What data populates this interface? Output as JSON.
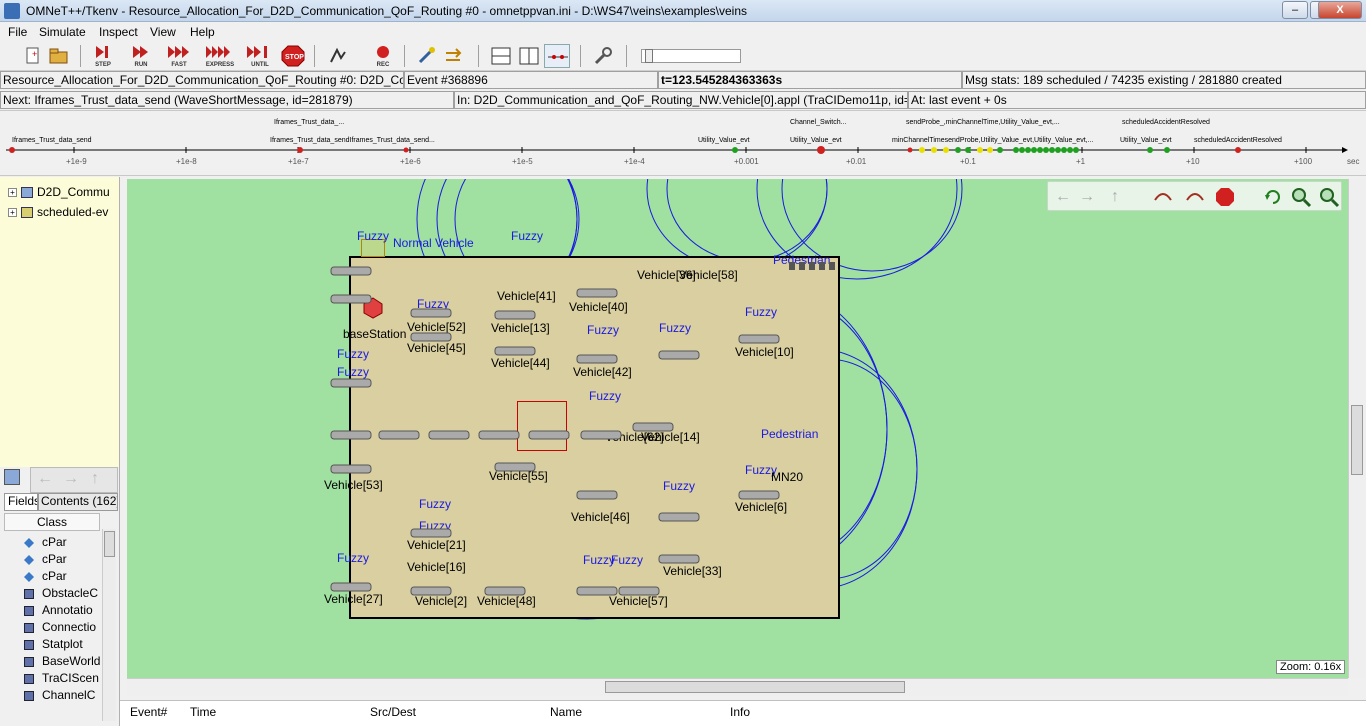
{
  "window": {
    "title": "OMNeT++/Tkenv - Resource_Allocation_For_D2D_Communication_QoF_Routing #0 - omnetppvan.ini - D:\\WS47\\veins\\examples\\veins",
    "minimize": "–",
    "maximize": "□",
    "close": "X"
  },
  "menu": [
    "File",
    "Simulate",
    "Inspect",
    "View",
    "Help"
  ],
  "toolbar": {
    "step": "STEP",
    "run": "RUN",
    "fast": "FAST",
    "express": "EXPRESS",
    "until": "UNTIL",
    "stop": "STOP",
    "rec": "REC"
  },
  "status1": {
    "network": "Resource_Allocation_For_D2D_Communication_QoF_Routing #0: D2D_Communication_and_QoF_Routing_NW",
    "event": "Event #368896",
    "time": "t=123.545284363363s",
    "msgstats": "Msg stats: 189 scheduled / 74235 existing / 281880 created"
  },
  "status2": {
    "next": "Next: Iframes_Trust_data_send (WaveShortMessage, id=281879)",
    "in": "In: D2D_Communication_and_QoF_Routing_NW.Vehicle[0].appl (TraCIDemo11p, id=5)",
    "at": "At: last event + 0s"
  },
  "timeline": {
    "ticks": [
      "+1e-9",
      "+1e-8",
      "+1e-7",
      "+1e-6",
      "+1e-5",
      "+1e-4",
      "+0.001",
      "+0.01",
      "+0.1",
      "+1",
      "+10",
      "+100"
    ],
    "unit": "sec",
    "labels": [
      "Iframes_Trust_data_send",
      "Iframes_Trust_data_...",
      "Iframes_Trust_data_sendIframes_Trust_data_send...",
      "Utility_Value_evt",
      "Channel_Switch...",
      "Utility_Value_evt",
      "sendProbe_,minChannelTime,Utility_Value_evt,...",
      "minChannelTimesendProbe,Utility_Value_evt,Utility_Value_evt,...",
      "scheduledAccidentResolved",
      "Utility_Value_evt",
      "scheduledAccidentResolved"
    ]
  },
  "tree": {
    "items": [
      "D2D_Commu",
      "scheduled-ev"
    ]
  },
  "inspector": {
    "tab_fields": "Fields",
    "tab_contents": "Contents (162)",
    "col_class": "Class",
    "rows": [
      "cPar",
      "cPar",
      "cPar",
      "ObstacleC",
      "Annotatio",
      "Connectio",
      "Statplot",
      "BaseWorld",
      "TraCIScen",
      "ChannelC"
    ]
  },
  "canvas": {
    "zoom": "Zoom: 0.16x",
    "labels": {
      "normal_vehicle": "Normal Vehicle",
      "base_station": "baseStation",
      "vehicles": [
        "Vehicle[41]",
        "Vehicle[40]",
        "Vehicle[36]",
        "Vehicle[58]",
        "Vehicle[52]",
        "Vehicle[45]",
        "Vehicle[13]",
        "Vehicle[10]",
        "Vehicle[44]",
        "Vehicle[42]",
        "Vehicle[53]",
        "Vehicle[55]",
        "Vehicle[46]",
        "Vehicle[6]",
        "Vehicle[21]",
        "Vehicle[16]",
        "Vehicle[33]",
        "Vehicle[27]",
        "Vehicle[48]",
        "Vehicle[57]",
        "Vehicle[62]",
        "Vehicle[14]",
        "Vehicle[2]"
      ],
      "fuzzy": "Fuzzy",
      "mn20": "MN20",
      "pedestrian": "Pedestrian"
    }
  },
  "log": {
    "cols": [
      "Event#",
      "Time",
      "Src/Dest",
      "Name",
      "Info"
    ]
  }
}
